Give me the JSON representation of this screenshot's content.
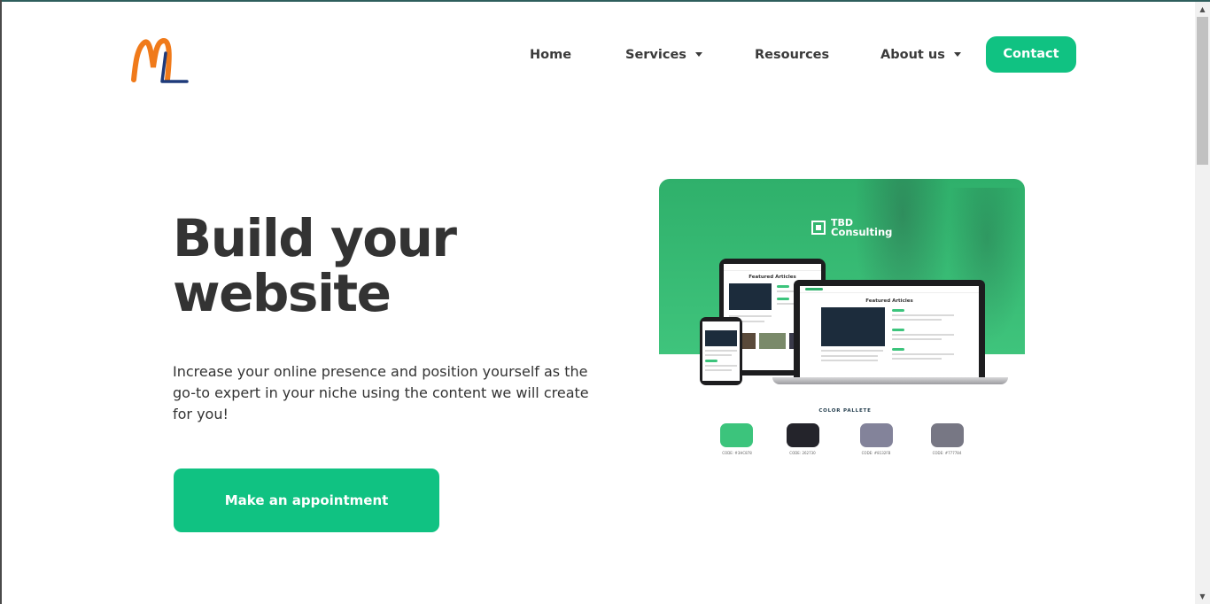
{
  "nav": {
    "home": "Home",
    "services": "Services",
    "resources": "Resources",
    "about": "About us",
    "contact": "Contact"
  },
  "hero": {
    "title_line1": "Build your",
    "title_line2": "website",
    "description": "Increase your online presence and position yourself as the go-to expert in your niche using the content we will create for you!",
    "cta": "Make an appointment"
  },
  "mockup": {
    "brand_line1": "TBD",
    "brand_line2": "Consulting",
    "screen_title": "Featured Articles",
    "palette_title": "COLOR PALLETE",
    "swatches": [
      {
        "color": "#3cc47c",
        "label": "CODE: #3HC878"
      },
      {
        "color": "#24242b",
        "label": "CODE: 262730"
      },
      {
        "color": "#83839a",
        "label": "CODE: #8132FB"
      },
      {
        "color": "#777784",
        "label": "CODE: #777784"
      }
    ]
  },
  "colors": {
    "accent": "#10c282",
    "text": "#333333",
    "logo_orange": "#f07a1a",
    "logo_navy": "#1e3a7a"
  }
}
